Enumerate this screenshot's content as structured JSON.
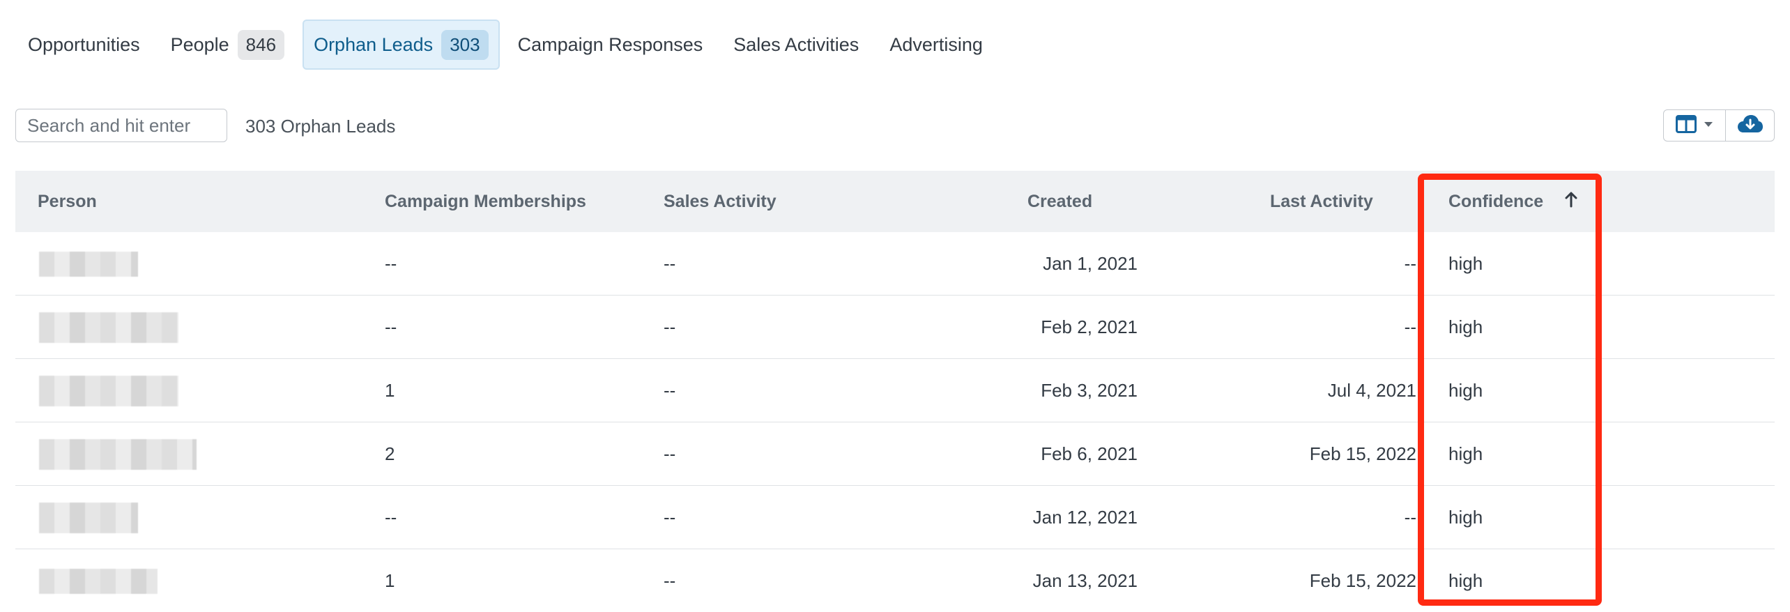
{
  "tabs": [
    {
      "label": "Opportunities",
      "count": null
    },
    {
      "label": "People",
      "count": "846"
    },
    {
      "label": "Orphan Leads",
      "count": "303"
    },
    {
      "label": "Campaign Responses",
      "count": null
    },
    {
      "label": "Sales Activities",
      "count": null
    },
    {
      "label": "Advertising",
      "count": null
    }
  ],
  "toolbar": {
    "search_placeholder": "Search and hit enter",
    "result_count": "303 Orphan Leads",
    "columns_icon": "columns-icon",
    "download_icon": "cloud-download-icon"
  },
  "table": {
    "columns": [
      "Person",
      "Campaign Memberships",
      "Sales Activity",
      "Created",
      "Last Activity",
      "Confidence"
    ],
    "sort": {
      "column": "Confidence",
      "direction": "ascending",
      "icon": "arrow-up-icon"
    },
    "rows": [
      {
        "memberships": "--",
        "sales_activity": "--",
        "created": "Jan 1, 2021",
        "last_activity": "--",
        "confidence": "high"
      },
      {
        "memberships": "--",
        "sales_activity": "--",
        "created": "Feb 2, 2021",
        "last_activity": "--",
        "confidence": "high"
      },
      {
        "memberships": "1",
        "sales_activity": "--",
        "created": "Feb 3, 2021",
        "last_activity": "Jul 4, 2021",
        "confidence": "high"
      },
      {
        "memberships": "2",
        "sales_activity": "--",
        "created": "Feb 6, 2021",
        "last_activity": "Feb 15, 2022",
        "confidence": "high"
      },
      {
        "memberships": "--",
        "sales_activity": "--",
        "created": "Jan 12, 2021",
        "last_activity": "--",
        "confidence": "high"
      },
      {
        "memberships": "1",
        "sales_activity": "--",
        "created": "Jan 13, 2021",
        "last_activity": "Feb 15, 2022",
        "confidence": "high"
      }
    ]
  },
  "colors": {
    "accent": "#0f5d8c",
    "highlight": "#ff2a12",
    "header_bg": "#eff1f3"
  }
}
